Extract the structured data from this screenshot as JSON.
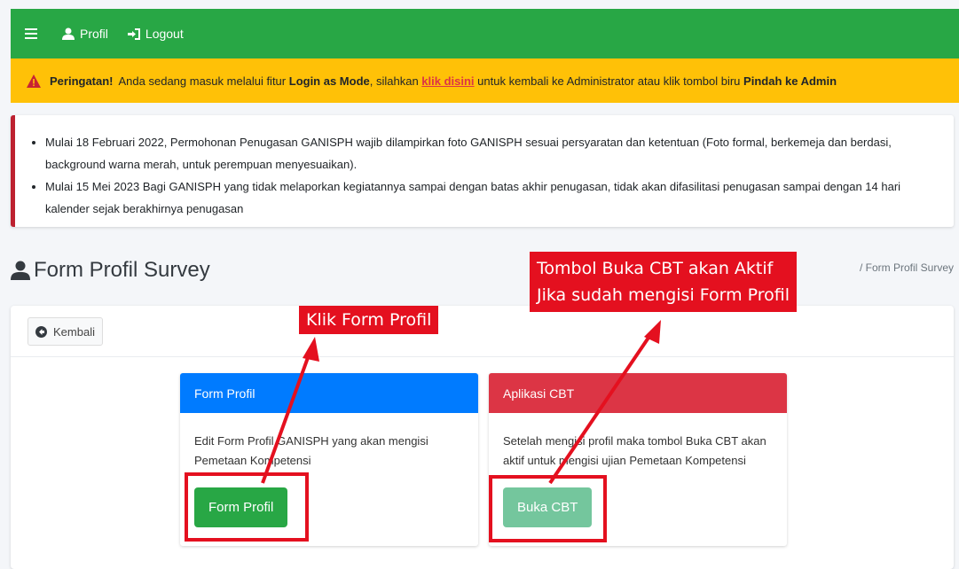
{
  "navbar": {
    "menu_icon": "hamburger-icon",
    "profile_icon": "user-icon",
    "profile_label": "Profil",
    "logout_icon": "sign-out-icon",
    "logout_label": "Logout",
    "color": "#28a745"
  },
  "warning": {
    "icon": "warning-triangle-icon",
    "lead": "Peringatan!",
    "text_1": "Anda sedang masuk melalui fitur",
    "mode": "Login as Mode",
    "text_2": ", silahkan",
    "link": "klik disini",
    "text_3": "untuk kembali ke Administrator atau klik tombol biru",
    "admin": "Pindah ke Admin",
    "color": "#ffc107"
  },
  "notices": [
    "Mulai 18 Februari 2022, Permohonan Penugasan GANISPH wajib dilampirkan foto GANISPH sesuai persyaratan dan ketentuan (Foto formal, berkemeja dan berdasi, background warna merah, untuk perempuan menyesuaikan).",
    "Mulai 15 Mei 2023 Bagi GANISPH yang tidak melaporkan kegiatannya sampai dengan batas akhir penugasan, tidak akan difasilitasi penugasan sampai dengan 14 hari kalender sejak berakhirnya penugasan"
  ],
  "page": {
    "title_icon": "user-icon",
    "title": "Form Profil Survey",
    "breadcrumb": "/ Form Profil Survey"
  },
  "back_button": {
    "icon": "arrow-circle-left-icon",
    "label": "Kembali"
  },
  "cards": {
    "profile": {
      "header": "Form Profil",
      "body": "Edit Form Profil GANISPH yang akan mengisi Pemetaan Kompetensi",
      "button": "Form Profil",
      "header_color": "#007bff"
    },
    "cbt": {
      "header": "Aplikasi CBT",
      "body": "Setelah mengisi profil maka tombol Buka CBT akan aktif untuk mengisi ujian Pemetaan Kompetensi",
      "button": "Buka CBT",
      "header_color": "#dc3545"
    }
  },
  "annotations": {
    "klik_form_profil": "Klik Form Profil",
    "cbt_line_1": "Tombol Buka CBT akan Aktif",
    "cbt_line_2": "Jika sudah mengisi Form Profil",
    "color": "#e4101f"
  }
}
